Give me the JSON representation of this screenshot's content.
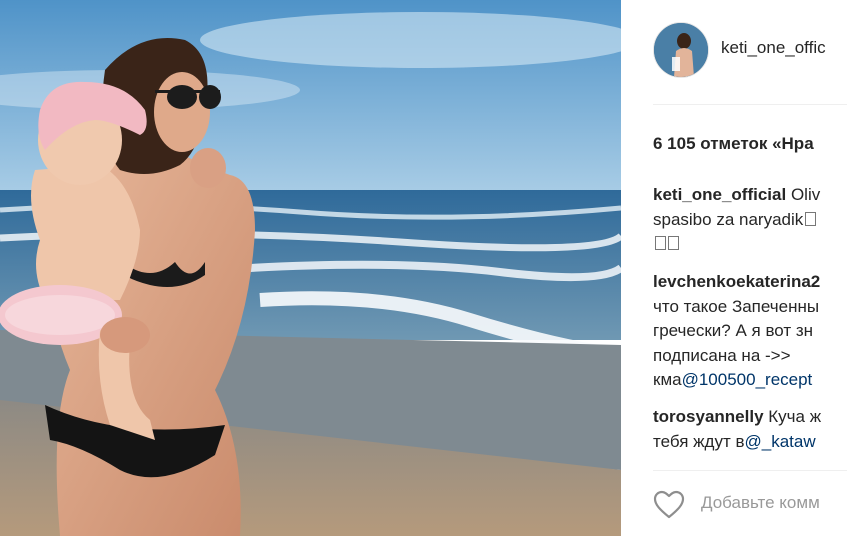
{
  "post": {
    "username": "keti_one_offic",
    "likes_text": "6 105 отметок «Нра",
    "comments": [
      {
        "author": "keti_one_official",
        "lines": [
          " Oliv",
          "spasibo za naryadik"
        ],
        "emoji_count_line1": 1,
        "emoji_count_line2": 2
      },
      {
        "author": "levchenkoekaterina2",
        "lines": [
          "что такое Запеченны",
          "гречески? А я вот зн",
          "подписана на ->>",
          "кма"
        ],
        "mention": "@100500_recept"
      },
      {
        "author": "torosyannelly",
        "lines": [
          " Куча ж",
          "тебя ждут в"
        ],
        "mention": "@_kataw"
      }
    ],
    "add_comment_placeholder": "Добавьте комм"
  },
  "icons": {
    "like": "heart-icon",
    "avatar": "avatar"
  },
  "colors": {
    "text": "#262626",
    "mention": "#003569",
    "placeholder": "#999999",
    "divider": "#efefef"
  }
}
